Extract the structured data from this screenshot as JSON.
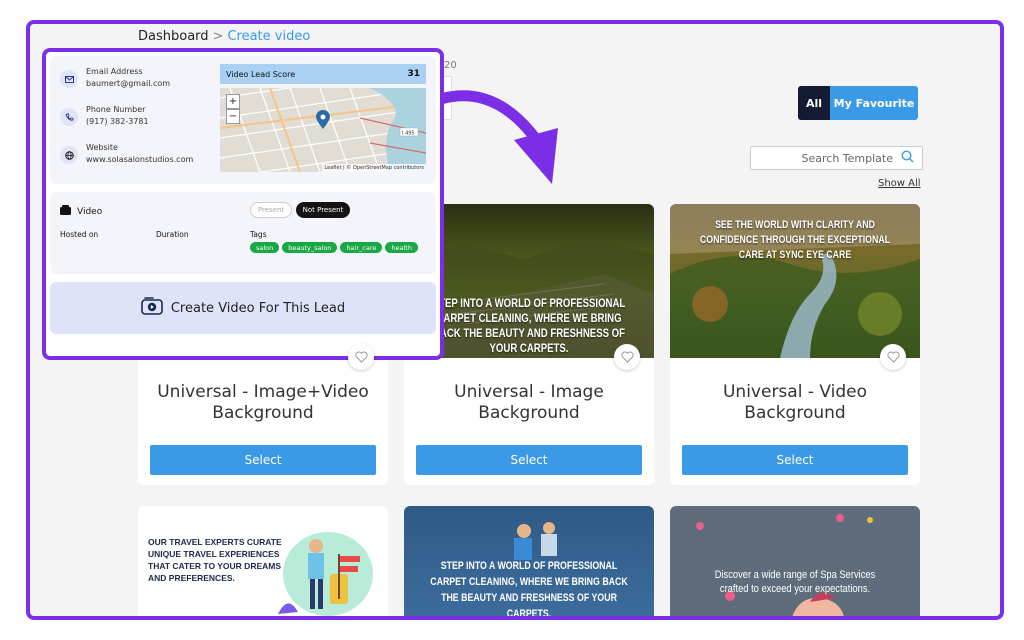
{
  "breadcrumb": {
    "root": "Dashboard",
    "separator": ">",
    "current": "Create video"
  },
  "background_hint": "20",
  "filter": {
    "all_label": "All",
    "favourite_label": "My Favourite"
  },
  "search": {
    "placeholder": "Search Template"
  },
  "show_all": "Show All",
  "templates": [
    {
      "title": "Universal - Image+Video Background",
      "select_label": "Select",
      "caption": ""
    },
    {
      "title": "Universal - Image Background",
      "select_label": "Select",
      "caption": "STEP INTO A WORLD OF PROFESSIONAL CARPET CLEANING, WHERE WE BRING BACK THE BEAUTY AND FRESHNESS OF YOUR CARPETS."
    },
    {
      "title": "Universal - Video Background",
      "select_label": "Select",
      "caption": "SEE THE WORLD WITH CLARITY AND CONFIDENCE THROUGH THE EXCEPTIONAL CARE AT SYNC EYE CARE"
    }
  ],
  "templates_row2": [
    {
      "caption": "OUR TRAVEL EXPERTS CURATE UNIQUE TRAVEL EXPERIENCES THAT CATER TO YOUR DREAMS AND PREFERENCES."
    },
    {
      "caption": "STEP INTO A WORLD OF PROFESSIONAL CARPET CLEANING, WHERE WE BRING BACK THE BEAUTY AND FRESHNESS OF YOUR CARPETS."
    },
    {
      "caption": "Discover a wide range of Spa Services crafted to exceed your expectations."
    }
  ],
  "lead": {
    "email_label": "Email Address",
    "email": "baumert@gmail.com",
    "phone_label": "Phone Number",
    "phone": "(917) 382-3781",
    "website_label": "Website",
    "website": "www.solasalonstudios.com",
    "score_label": "Video Lead Score",
    "score": "31",
    "map_attribution": "Leaflet | © OpenStreetMap contributors",
    "map_zoom_in": "+",
    "map_zoom_out": "−",
    "map_label": "I 495",
    "video_label": "Video",
    "present_label": "Present",
    "not_present_label": "Not Present",
    "hosted_on_label": "Hosted on",
    "duration_label": "Duration",
    "tags_label": "Tags",
    "tags": [
      "salon",
      "beauty_salon",
      "hair_care",
      "health"
    ],
    "create_label": "Create Video For This Lead"
  },
  "colors": {
    "accent": "#7c2ee6",
    "primary": "#3b9ae8",
    "tag": "#18a845",
    "dark": "#151a33"
  }
}
